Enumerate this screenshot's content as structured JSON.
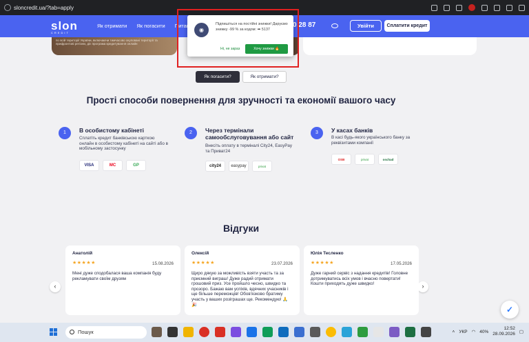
{
  "browser": {
    "url": "sloncredit.ua/?tab=apply"
  },
  "nav": {
    "logo": "slon",
    "logo_sub": "CREDIT",
    "links": [
      "Як отримати",
      "Як погасити",
      "Питання та..."
    ],
    "phone": "0 28 87",
    "login": "Увійти",
    "pay": "Сплатити кредит"
  },
  "hero_small_text": "по всій території України, включаючи тимчасово окуповані території та прифронтові регіони, діє програма кредитування онлайн",
  "tabs": {
    "active": "Як погасити?",
    "other": "Як отримати?"
  },
  "title": "Прості способи повернення для зручності та економії вашого часу",
  "methods": [
    {
      "n": "1",
      "title": "В особистому кабінеті",
      "desc": "Сплатіть кредит банківською карткою онлайн в особистому кабінеті на сайті або в мобільному застосунку",
      "logos": [
        "VISA",
        "MC",
        "GP"
      ]
    },
    {
      "n": "2",
      "title": "Через термінали самообслуговування або сайт",
      "desc": "Внесіть оплату в терміналі City24, EasyPay та Приват24",
      "logos": [
        "city24",
        "easypay",
        "privat"
      ]
    },
    {
      "n": "3",
      "title": "У касах банків",
      "desc": "В касі будь-якого українського банку за реквізитами компанії",
      "logos": [
        "OSB",
        "privat",
        "oschad"
      ]
    }
  ],
  "reviews_title": "Відгуки",
  "reviews": [
    {
      "name": "Анатолій",
      "stars": "★★★★★",
      "date": "15.08.2026",
      "text": "Мені дуже сподобалася ваша компанія буду рекламувати своїм друзям"
    },
    {
      "name": "Олексій",
      "stars": "★★★★★",
      "date": "23.07.2026",
      "text": "Щиро дякую за можливість взяти участь та за приємний виграш! Дуже радий отримати грошовий приз. Усе пройшло чесно, швидко та прозоро. Бажаю вам успіхів, вдячних учасників і ще більше переможців! Обов'язково братиму участь у ваших розіграшах ще. Рекомендую! 🙏🎉"
    },
    {
      "name": "Юлія Тесленко",
      "stars": "★★★★★",
      "date": "17.05.2026",
      "text": "Дуже гарний сервіс з надання кредитів! Головне дотримуватись всіх умов і вчасно повертати! Кошти приходять дуже швидко!"
    }
  ],
  "popup": {
    "text": "Підпишіться на постійні знижки! Даруємо знижку -99 % за кодом: ➡ 5137",
    "no": "Ні, не зараз",
    "yes": "Хочу знижки 🔥"
  },
  "taskbar": {
    "search": "Пошук",
    "lang": "УКР",
    "battery": "40%",
    "time": "12:52",
    "date": "28.09.2026"
  }
}
